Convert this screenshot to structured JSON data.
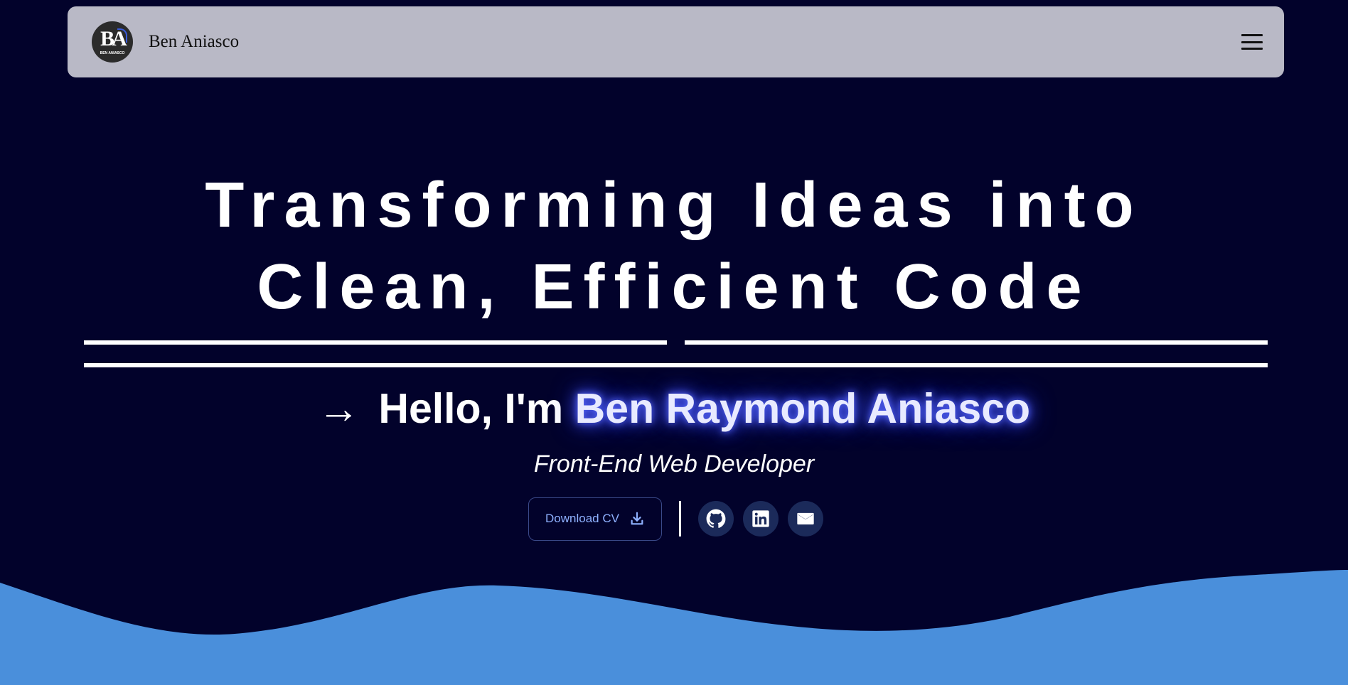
{
  "navbar": {
    "brand_name": "Ben Aniasco",
    "logo_initials": "BA",
    "logo_subtext": "BEN ANIASCO"
  },
  "hero": {
    "headline_line1": "Transforming Ideas into",
    "headline_line2": "Clean, Efficient Code",
    "greeting_arrow": "→",
    "greeting_prefix": "Hello, I'm",
    "greeting_name": "Ben Raymond Aniasco",
    "role": "Front-End Web Developer"
  },
  "actions": {
    "download_cv_label": "Download CV"
  },
  "icons": {
    "menu": "hamburger-menu-icon",
    "download": "download-icon",
    "github": "github-icon",
    "linkedin": "linkedin-icon",
    "email": "mail-icon"
  },
  "colors": {
    "background": "#02022b",
    "navbar": "#b9b9c6",
    "wave": "#4a8fdb",
    "accent_text": "#8fb1ff",
    "glow": "#5b6bff"
  }
}
